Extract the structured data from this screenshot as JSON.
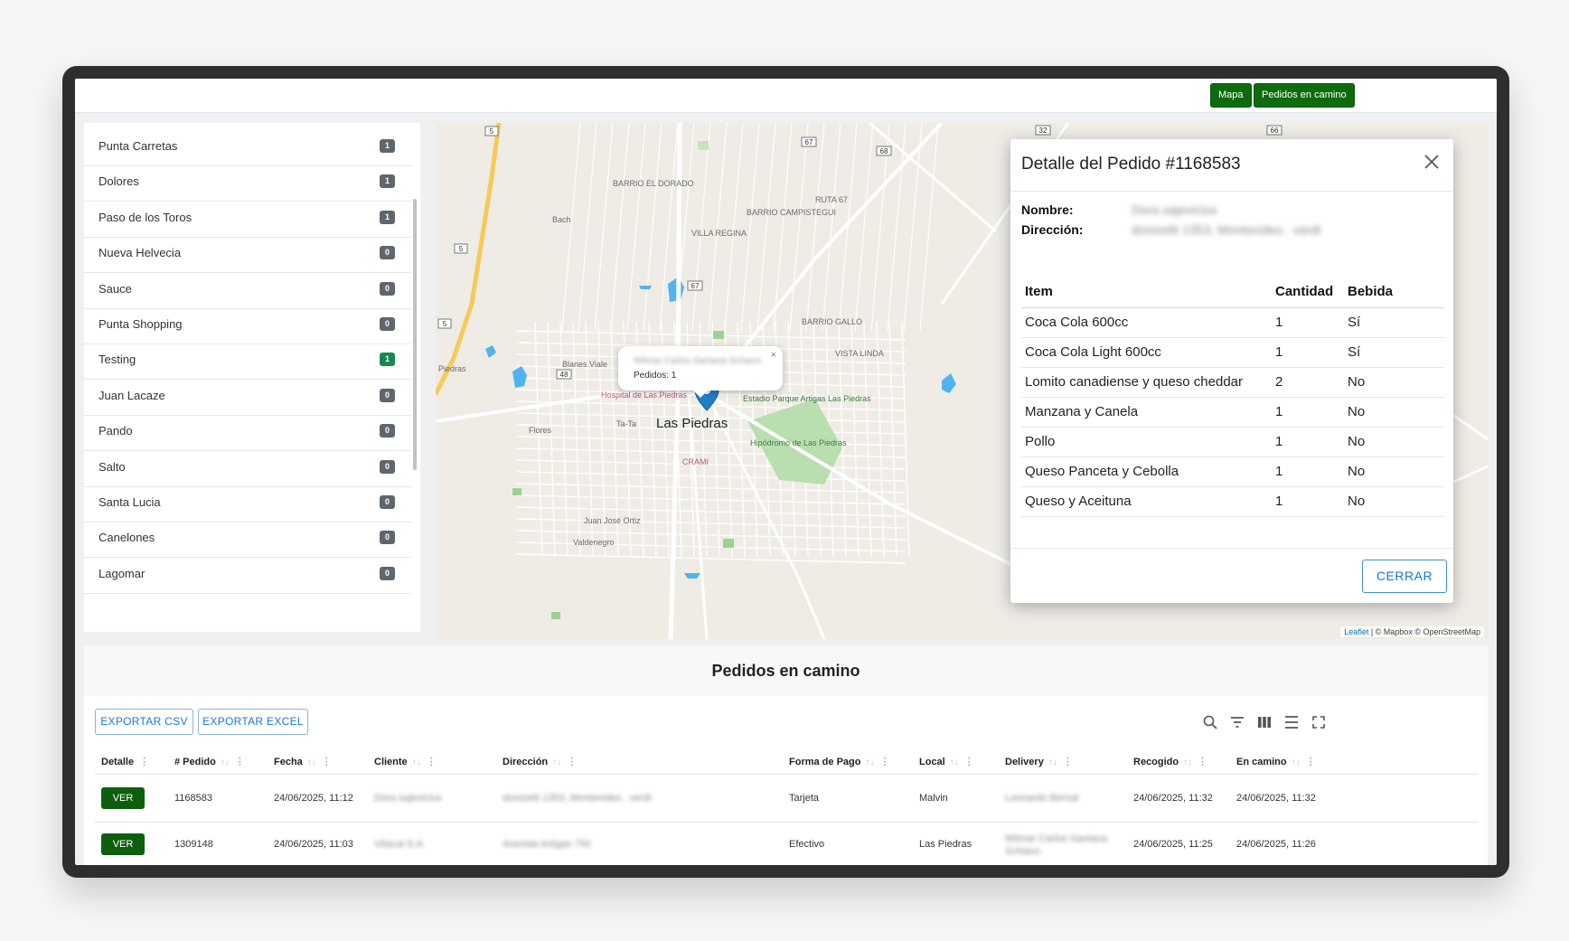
{
  "topbar": {
    "mapa_label": "Mapa",
    "pedidos_label": "Pedidos en camino"
  },
  "sidebar": {
    "items": [
      {
        "label": "Punta Carretas",
        "count": "1",
        "highlight": false
      },
      {
        "label": "Dolores",
        "count": "1",
        "highlight": false
      },
      {
        "label": "Paso de los Toros",
        "count": "1",
        "highlight": false
      },
      {
        "label": "Nueva Helvecia",
        "count": "0",
        "highlight": false
      },
      {
        "label": "Sauce",
        "count": "0",
        "highlight": false
      },
      {
        "label": "Punta Shopping",
        "count": "0",
        "highlight": false
      },
      {
        "label": "Testing",
        "count": "1",
        "highlight": true
      },
      {
        "label": "Juan Lacaze",
        "count": "0",
        "highlight": false
      },
      {
        "label": "Pando",
        "count": "0",
        "highlight": false
      },
      {
        "label": "Salto",
        "count": "0",
        "highlight": false
      },
      {
        "label": "Santa Lucia",
        "count": "0",
        "highlight": false
      },
      {
        "label": "Canelones",
        "count": "0",
        "highlight": false
      },
      {
        "label": "Lagomar",
        "count": "0",
        "highlight": false
      }
    ]
  },
  "map": {
    "city_label": "Las Piedras",
    "labels": {
      "barrio_el_dorado": "BARRIO EL DORADO",
      "villa_regina": "VILLA REGINA",
      "barrio_campistegui": "BARRIO CAMPISTEGUI",
      "ruta_67": "RUTA 67",
      "barrio_gallo": "BARRIO GALLO",
      "vista_linda": "VISTA LINDA",
      "blanes_viale": "Blanes Viale",
      "flores": "Flores",
      "valdenegro": "Valdenegro",
      "juan_jose_ortiz": "Juan José Ortiz",
      "bach": "Bach",
      "piedras": "Piedras",
      "ta_ta": "Ta-Ta",
      "crami": "CRAMI",
      "hospital": "Hospital de Las Piedras",
      "estadio": "Estadio Parque Artigas Las Piedras",
      "hipodromo": "Hipódromo de Las Piedras"
    },
    "route_shields": [
      "5",
      "5",
      "5",
      "48",
      "67",
      "67",
      "68",
      "32",
      "66"
    ],
    "popup": {
      "name": "Wilmar Carlos Santana Schiavo",
      "count": "Pedidos: 1",
      "close": "×"
    },
    "attribution": {
      "leaflet": "Leaflet",
      "rest": " | © Mapbox © OpenStreetMap"
    }
  },
  "modal": {
    "title": "Detalle del Pedido #1168583",
    "nombre_label": "Nombre:",
    "nombre_value": "Dora sajevicius",
    "direccion_label": "Dirección:",
    "direccion_value": "donizetti 1353, Montevideo . verdi",
    "table_headers": [
      "Item",
      "Cantidad",
      "Bebida"
    ],
    "items": [
      {
        "item": "Coca Cola 600cc",
        "cantidad": "1",
        "bebida": "Sí"
      },
      {
        "item": "Coca Cola Light 600cc",
        "cantidad": "1",
        "bebida": "Sí"
      },
      {
        "item": "Lomito canadiense y queso cheddar",
        "cantidad": "2",
        "bebida": "No"
      },
      {
        "item": "Manzana y Canela",
        "cantidad": "1",
        "bebida": "No"
      },
      {
        "item": "Pollo",
        "cantidad": "1",
        "bebida": "No"
      },
      {
        "item": "Queso Panceta y Cebolla",
        "cantidad": "1",
        "bebida": "No"
      },
      {
        "item": "Queso y Aceituna",
        "cantidad": "1",
        "bebida": "No"
      }
    ],
    "close_button": "CERRAR"
  },
  "panel": {
    "title": "Pedidos en camino",
    "export_csv": "EXPORTAR CSV",
    "export_excel": "EXPORTAR EXCEL",
    "columns": [
      "Detalle",
      "# Pedido",
      "Fecha",
      "Cliente",
      "Dirección",
      "Forma de Pago",
      "Local",
      "Delivery",
      "Recogido",
      "En camino"
    ],
    "rows": [
      {
        "detalle": "VER",
        "pedido": "1168583",
        "fecha": "24/06/2025, 11:12",
        "cliente": "Dora sajevicius",
        "direccion": "donizetti 1353, Montevideo . verdi",
        "pago": "Tarjeta",
        "local": "Malvin",
        "delivery": "Leonardo Bernal",
        "recogido": "24/06/2025, 11:32",
        "en_camino": "24/06/2025, 11:32"
      },
      {
        "detalle": "VER",
        "pedido": "1309148",
        "fecha": "24/06/2025, 11:03",
        "cliente": "Vitacal S.A.",
        "direccion": "Avenida Artigas 750",
        "pago": "Efectivo",
        "local": "Las Piedras",
        "delivery": "Wilmar Carlos Santana Schiavo",
        "recogido": "24/06/2025, 11:25",
        "en_camino": "24/06/2025, 11:26"
      }
    ]
  },
  "colors": {
    "accent_green": "#0d6b0d",
    "badge_gray": "#5f666d",
    "badge_green": "#198754",
    "link_blue": "#1976d2"
  }
}
